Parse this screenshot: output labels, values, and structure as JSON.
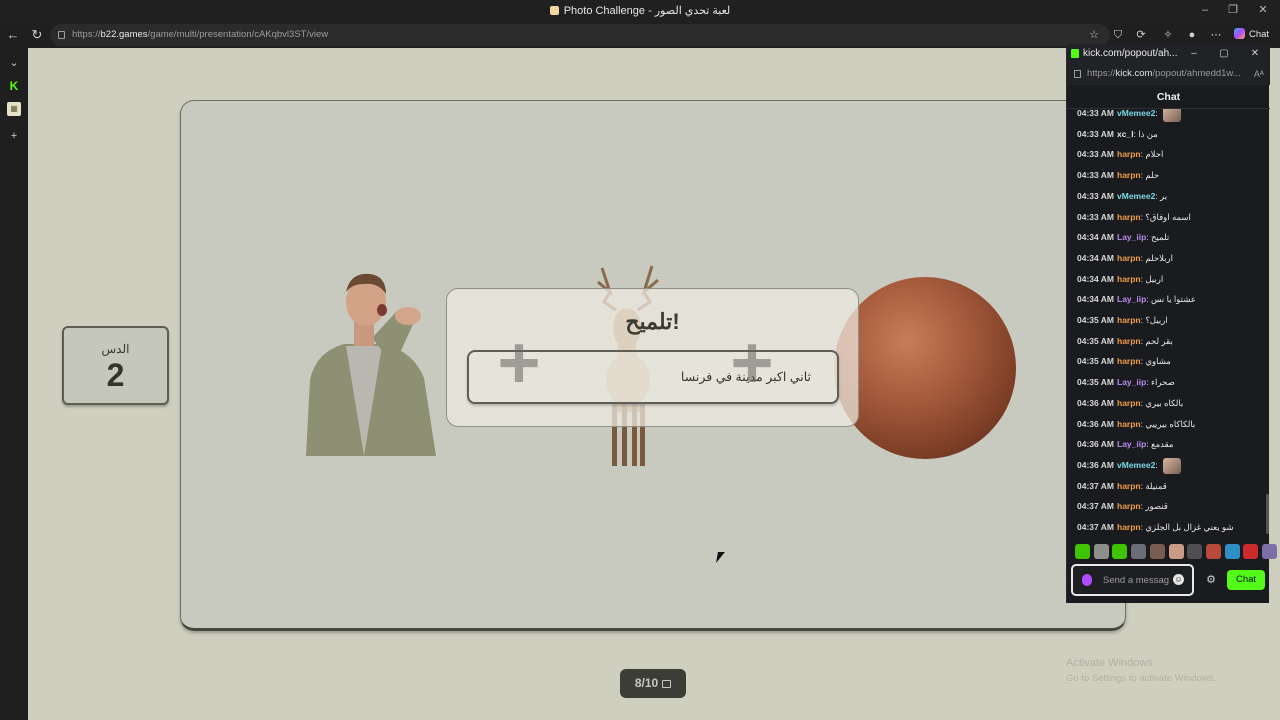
{
  "browser": {
    "window_title": "Photo Challenge - لعبة تحدي الصور",
    "url_prefix": "https://",
    "url_host": "b22.games",
    "url_path": "/game/multi/presentation/cAKqbvl3ST/view",
    "copilot_label": "Chat"
  },
  "game": {
    "score_label": "الدس",
    "score_value": "2",
    "hint_title": "تلميح!",
    "hint_text": "ثاني اكبر مدينة في فرنسا",
    "counter": "8/10",
    "watermark_line1": "Activate Windows",
    "watermark_line2": "Go to Settings to activate Windows."
  },
  "chat": {
    "popout_title": "kick.com/popout/ah...",
    "popout_url_prefix": "https://",
    "popout_url_host": "kick.com",
    "popout_url_path": "/popout/ahmedd1w...",
    "header": "Chat",
    "input_placeholder": "Send a message",
    "send_label": "Chat",
    "user_colors": {
      "vMemee2": "#7ad8e3",
      "xc_l": "#e6e6e6",
      "harpn": "#f39c4a",
      "Lay_iip": "#b98cf0"
    },
    "messages": [
      {
        "time": "04:33 AM",
        "user": "vMemee2",
        "text": "",
        "emote": true
      },
      {
        "time": "04:33 AM",
        "user": "xc_l",
        "text": "من ذا",
        "emote": false
      },
      {
        "time": "04:33 AM",
        "user": "harpn",
        "text": "احلام",
        "emote": false
      },
      {
        "time": "04:33 AM",
        "user": "harpn",
        "text": "حلم",
        "emote": false
      },
      {
        "time": "04:33 AM",
        "user": "vMemee2",
        "text": "بر",
        "emote": false
      },
      {
        "time": "04:33 AM",
        "user": "harpn",
        "text": "اسمه اوفاق؟",
        "emote": false
      },
      {
        "time": "04:34 AM",
        "user": "Lay_iip",
        "text": "تلميح",
        "emote": false
      },
      {
        "time": "04:34 AM",
        "user": "harpn",
        "text": "اربلاحلم",
        "emote": false
      },
      {
        "time": "04:34 AM",
        "user": "harpn",
        "text": "اربيل",
        "emote": false
      },
      {
        "time": "04:34 AM",
        "user": "Lay_iip",
        "text": "عشتوا يا نس",
        "emote": false
      },
      {
        "time": "04:35 AM",
        "user": "harpn",
        "text": "اربيل؟",
        "emote": false
      },
      {
        "time": "04:35 AM",
        "user": "harpn",
        "text": "بقر لحم",
        "emote": false
      },
      {
        "time": "04:35 AM",
        "user": "harpn",
        "text": "مشاوي",
        "emote": false
      },
      {
        "time": "04:35 AM",
        "user": "Lay_iip",
        "text": "صحراء",
        "emote": false
      },
      {
        "time": "04:36 AM",
        "user": "harpn",
        "text": "بالكاه بيري",
        "emote": false
      },
      {
        "time": "04:36 AM",
        "user": "harpn",
        "text": "بالكاكاه بيرييي",
        "emote": false
      },
      {
        "time": "04:36 AM",
        "user": "Lay_iip",
        "text": "مقدمع",
        "emote": false
      },
      {
        "time": "04:36 AM",
        "user": "vMemee2",
        "text": "",
        "emote": true
      },
      {
        "time": "04:37 AM",
        "user": "harpn",
        "text": "قمنيلة",
        "emote": false
      },
      {
        "time": "04:37 AM",
        "user": "harpn",
        "text": "قنصور",
        "emote": false
      },
      {
        "time": "04:37 AM",
        "user": "harpn",
        "text": "شو يعني غزال بل الجلزي",
        "emote": false
      }
    ]
  },
  "icons": {
    "back": "back-arrow-icon",
    "reload": "reload-icon",
    "favorite": "star-icon",
    "shield": "shield-icon",
    "extensions": "puzzle-icon",
    "profile": "profile-icon",
    "menu": "more-icon",
    "settings": "gear-icon",
    "mic": "mic-icon",
    "emoji": "smile-icon"
  },
  "colors": {
    "kick_green": "#53fc18",
    "page_bg": "#cecfbe",
    "stage_bg": "#c9cabf",
    "chat_bg": "#191b1f"
  }
}
